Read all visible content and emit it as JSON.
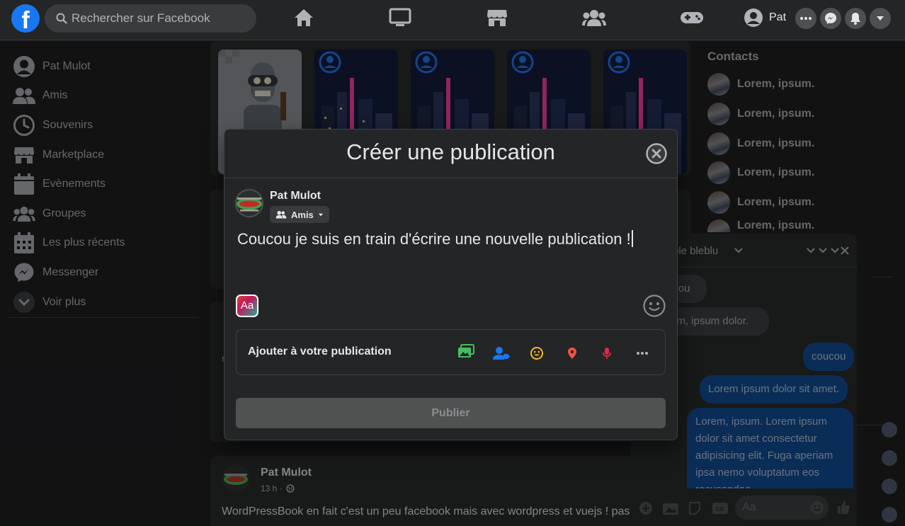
{
  "topbar": {
    "search_placeholder": "Rechercher sur Facebook",
    "profile_name": "Pat"
  },
  "sidebar": {
    "items": [
      {
        "label": "Pat Mulot",
        "icon": "user-avatar-icon"
      },
      {
        "label": "Amis",
        "icon": "friends-icon"
      },
      {
        "label": "Souvenirs",
        "icon": "clock-icon"
      },
      {
        "label": "Marketplace",
        "icon": "store-icon"
      },
      {
        "label": "Evènements",
        "icon": "calendar-icon"
      },
      {
        "label": "Groupes",
        "icon": "groups-icon"
      },
      {
        "label": "Les plus récents",
        "icon": "recent-calendar-icon"
      },
      {
        "label": "Messenger",
        "icon": "messenger-icon"
      },
      {
        "label": "Voir plus",
        "icon": "chevron-down-icon"
      }
    ]
  },
  "contacts": {
    "title": "Contacts",
    "names": [
      "Lorem, ipsum.",
      "Lorem, ipsum.",
      "Lorem, ipsum.",
      "Lorem, ipsum.",
      "Lorem, ipsum.",
      "Lorem, ipsum."
    ]
  },
  "chat": {
    "name": "ble bleblu",
    "messages": [
      {
        "dir": "in",
        "text": "ucou"
      },
      {
        "dir": "in",
        "text": "rem, ipsum dolor."
      },
      {
        "dir": "out",
        "text": "coucou"
      },
      {
        "dir": "out",
        "text": "Lorem ipsum dolor sit amet."
      },
      {
        "dir": "out",
        "text": "Lorem, ipsum. Lorem ipsum dolor sit amet consectetur adipisicing elit. Fuga aperiam ipsa nemo voluptatum eos recusandae"
      }
    ],
    "input_placeholder": "Aa"
  },
  "feed_post": {
    "author": "Pat Mulot",
    "meta": "13 h ·",
    "text": "WordPressBook en fait c'est un peu facebook mais avec wordpress et vuejs ! pas ?",
    "partial_label": "n"
  },
  "modal": {
    "title": "Créer une publication",
    "author": "Pat Mulot",
    "audience": "Amis",
    "post_text": "Coucou je suis en train d'écrire une nouvelle publication !",
    "aa_label": "Aa",
    "add_label": "Ajouter à votre publication",
    "publish_label": "Publier"
  },
  "colors": {
    "accent": "#1877f2",
    "background": "#18191a",
    "surface": "#242526",
    "photo_green": "#45bd62",
    "tag_blue": "#1877f2",
    "feeling_yellow": "#f7b928",
    "location_orange": "#f5533d",
    "mic_red": "#e42645"
  }
}
